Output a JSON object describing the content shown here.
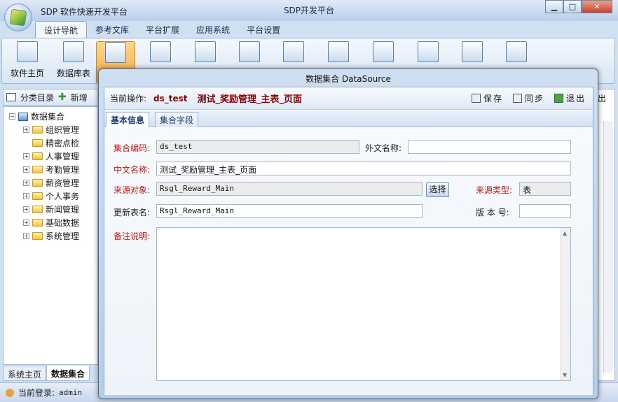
{
  "app": {
    "name": "SDP 软件快速开发平台",
    "window_title": "SDP开发平台"
  },
  "ribbon_tabs": [
    "设计导航",
    "参考文库",
    "平台扩展",
    "应用系统",
    "平台设置"
  ],
  "ribbon_buttons": [
    "软件主页",
    "数据库表"
  ],
  "left_panel": {
    "toolbar_catalog": "分类目录",
    "toolbar_new": "新增",
    "tree_root": "数据集合",
    "tree_items": [
      "组织管理",
      "精密点检",
      "人事管理",
      "考勤管理",
      "薪资管理",
      "个人事务",
      "新闻管理",
      "基础数据",
      "系统管理"
    ],
    "tabs": [
      "系统主页",
      "数据集合"
    ]
  },
  "status": {
    "login_label": "当前登录:",
    "user": "admin"
  },
  "background_right_label": "出",
  "dialog": {
    "title": "数据集合  DataSource",
    "op_label": "当前操作:",
    "op_code": "ds_test",
    "op_name": "测试_奖励管理_主表_页面",
    "actions": {
      "save": "保存",
      "sync": "同步",
      "exit": "退出"
    },
    "tabs": [
      "基本信息",
      "集合字段"
    ],
    "form": {
      "code_label": "集合编码:",
      "code_value": "ds_test",
      "foreign_label": "外文名称:",
      "foreign_value": "",
      "cn_label": "中文名称:",
      "cn_value": "测试_奖励管理_主表_页面",
      "source_label": "来源对象:",
      "source_value": "Rsgl_Reward_Main",
      "select_btn": "选择",
      "type_label": "来源类型:",
      "type_value": "表",
      "update_label": "更新表名:",
      "update_value": "Rsgl_Reward_Main",
      "version_label": "版 本 号:",
      "version_value": "",
      "remark_label": "备注说明:",
      "remark_value": ""
    }
  }
}
